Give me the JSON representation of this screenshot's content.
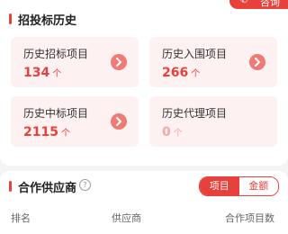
{
  "header": {
    "consult_label": "咨询",
    "section_title": "招投标历史"
  },
  "stats": [
    {
      "label": "历史招标项目",
      "value": "134",
      "unit": "个"
    },
    {
      "label": "历史入围项目",
      "value": "266",
      "unit": "个"
    },
    {
      "label": "历史中标项目",
      "value": "2115",
      "unit": "个"
    },
    {
      "label": "历史代理项目",
      "value": "0",
      "unit": "个"
    }
  ],
  "suppliers": {
    "title": "合作供应商",
    "help_glyph": "?",
    "toggle": {
      "active": "项目",
      "inactive": "金额"
    },
    "columns": [
      "排名",
      "供应商",
      "合作项目数"
    ]
  },
  "colors": {
    "accent": "#e8403a",
    "card_bg": "#fdf1f1"
  }
}
